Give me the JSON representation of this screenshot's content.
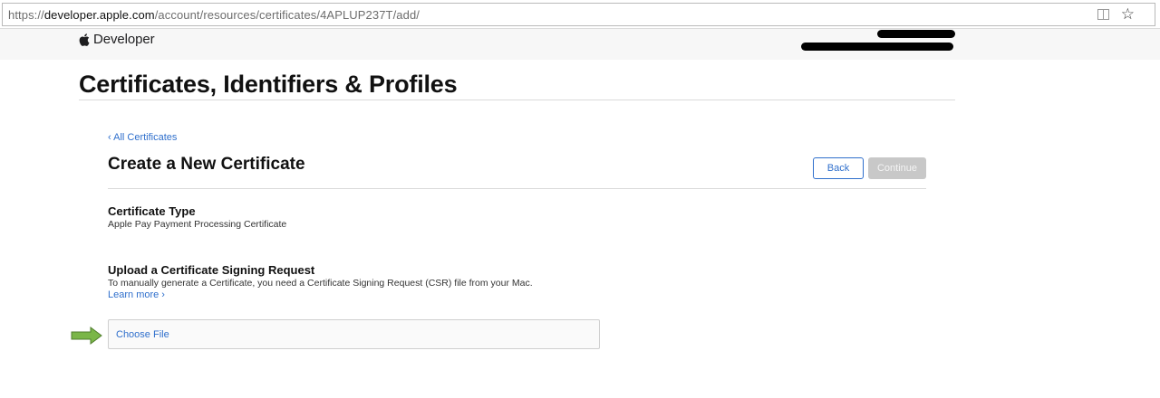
{
  "browser": {
    "url_prefix": "https://",
    "url_host": "developer.apple.com",
    "url_path": "/account/resources/certificates/4APLUP237T/add/",
    "reader_icon": "reader-view-icon",
    "bookmark_icon": "star-icon"
  },
  "header": {
    "logo_icon": "apple-icon",
    "logo_text": "Developer"
  },
  "page": {
    "title": "Certificates, Identifiers & Profiles"
  },
  "card": {
    "back_link": "‹ All Certificates",
    "title": "Create a New Certificate",
    "back_button": "Back",
    "continue_button": "Continue",
    "certificate_type_label": "Certificate Type",
    "certificate_type_value": "Apple Pay Payment Processing Certificate",
    "upload_label": "Upload a Certificate Signing Request",
    "upload_description": "To manually generate a Certificate, you need a Certificate Signing Request (CSR) file from your Mac.",
    "learn_more": "Learn more ›",
    "choose_file": "Choose File"
  },
  "colors": {
    "link_blue": "#2f6fcc",
    "disabled_gray": "#c8c8c8",
    "annotation_arrow": "#7ab648"
  }
}
